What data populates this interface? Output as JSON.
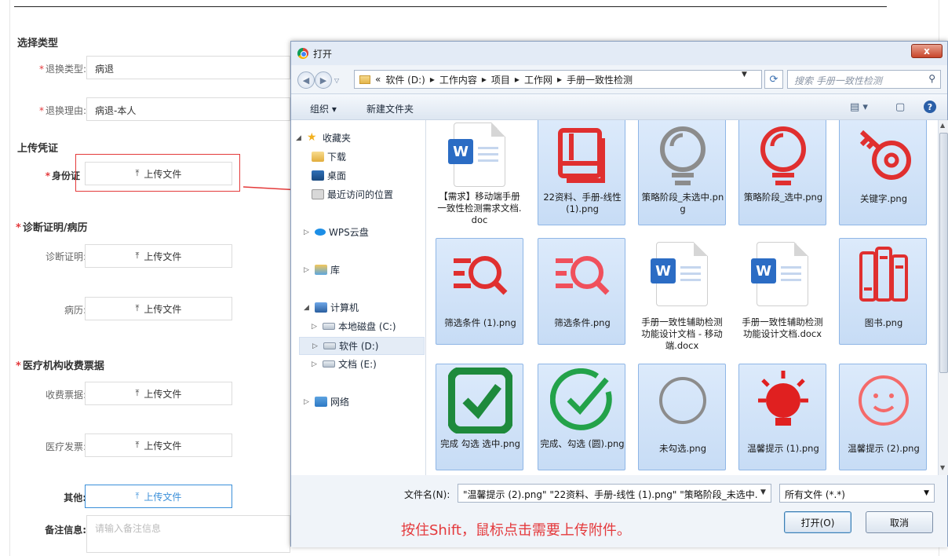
{
  "form": {
    "section_type": "选择类型",
    "return_type_label": "退换类型:",
    "return_type_value": "病退",
    "return_reason_label": "退换理由:",
    "return_reason_value": "病退-本人",
    "section_upload": "上传凭证",
    "id_label": "身份证",
    "upload_text": "上传文件",
    "section_diagnosis": "诊断证明/病历",
    "diagnosis_label": "诊断证明:",
    "medical_record_label": "病历:",
    "section_receipts": "医疗机构收费票据",
    "receipt_label": "收费票据:",
    "invoice_label": "医疗发票:",
    "other_label": "其他:",
    "notes_label": "备注信息:",
    "notes_placeholder": "请输入备注信息",
    "required_mark": "*"
  },
  "dialog": {
    "title": "打开",
    "close_label": "x",
    "path": [
      "«",
      "软件 (D:)",
      "工作内容",
      "项目",
      "工作网",
      "手册一致性检测"
    ],
    "search_placeholder": "搜索 手册一致性检测",
    "toolbar": {
      "organize": "组织 ▾",
      "new_folder": "新建文件夹"
    },
    "nav": {
      "favorites": "收藏夹",
      "downloads": "下载",
      "desktop": "桌面",
      "recent": "最近访问的位置",
      "wps": "WPS云盘",
      "library": "库",
      "computer": "计算机",
      "drive_c": "本地磁盘 (C:)",
      "drive_d": "软件 (D:)",
      "drive_e": "文档 (E:)",
      "network": "网络"
    },
    "files": [
      {
        "name": "【需求】移动端手册一致性检测需求文档.doc",
        "icon": "word-doc-icon",
        "selected": false
      },
      {
        "name": "22资料、手册-线性 (1).png",
        "icon": "book-icon",
        "selected": true
      },
      {
        "name": "策略阶段_未选中.png",
        "icon": "bulb-gray-icon",
        "selected": true
      },
      {
        "name": "策略阶段_选中.png",
        "icon": "bulb-red-icon",
        "selected": true
      },
      {
        "name": "关键字.png",
        "icon": "key-icon",
        "selected": true
      },
      {
        "name": "筛选条件 (1).png",
        "icon": "filter-search-red-icon",
        "selected": true
      },
      {
        "name": "筛选条件.png",
        "icon": "filter-search-pink-icon",
        "selected": true
      },
      {
        "name": "手册一致性辅助检测功能设计文档 - 移动端.docx",
        "icon": "word-docx-icon",
        "selected": false
      },
      {
        "name": "手册一致性辅助检测功能设计文档.docx",
        "icon": "word-docx-icon",
        "selected": false
      },
      {
        "name": "图书.png",
        "icon": "books-icon",
        "selected": true
      },
      {
        "name": "完成 勾选 选中.png",
        "icon": "check-square-green-icon",
        "selected": true
      },
      {
        "name": "完成、勾选 (圆).png",
        "icon": "check-circle-green-icon",
        "selected": true
      },
      {
        "name": "未勾选.png",
        "icon": "circle-gray-icon",
        "selected": true
      },
      {
        "name": "温馨提示 (1).png",
        "icon": "bulb-shine-icon",
        "selected": true
      },
      {
        "name": "温馨提示 (2).png",
        "icon": "smile-icon",
        "selected": true
      }
    ],
    "filename_label": "文件名(N):",
    "filename_value": "\"温馨提示 (2).png\" \"22资料、手册-线性 (1).png\" \"策略阶段_未选中.",
    "filetype_value": "所有文件 (*.*)",
    "open_button": "打开(O)",
    "cancel_button": "取消"
  },
  "annotation": "按住Shift，鼠标点击需要上传附件。",
  "colors": {
    "accent_red": "#e4393c",
    "link_blue": "#3a8fd9",
    "selection_blue": "#c7dcf5"
  }
}
